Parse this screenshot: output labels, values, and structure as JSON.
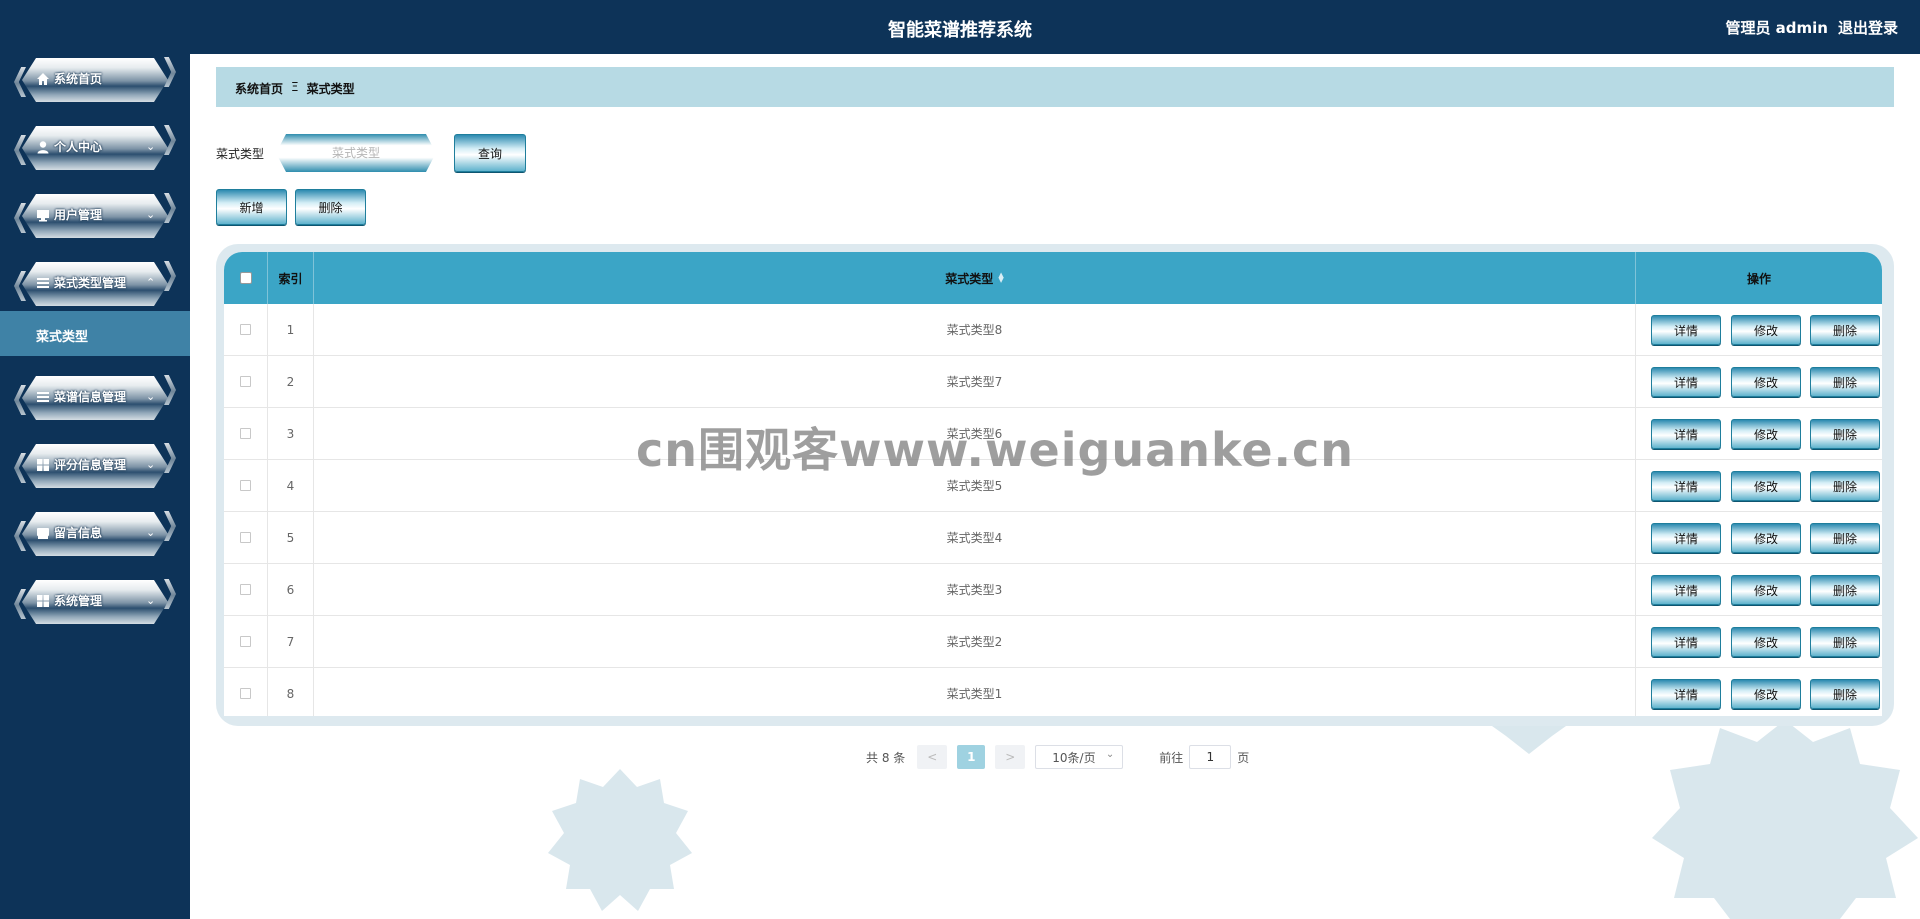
{
  "app": {
    "title": "智能菜谱推荐系统",
    "user_label": "管理员 admin",
    "logout_label": "退出登录"
  },
  "sidebar": {
    "items": [
      {
        "label": "系统首页",
        "icon": "home-icon",
        "arrow": ""
      },
      {
        "label": "个人中心",
        "icon": "user-icon",
        "arrow": "⌄"
      },
      {
        "label": "用户管理",
        "icon": "monitor-icon",
        "arrow": "⌄"
      },
      {
        "label": "菜式类型管理",
        "icon": "list-icon",
        "arrow": "⌃"
      },
      {
        "label": "菜谱信息管理",
        "icon": "list-icon",
        "arrow": "⌄"
      },
      {
        "label": "评分信息管理",
        "icon": "grid-icon",
        "arrow": "⌄"
      },
      {
        "label": "留言信息",
        "icon": "message-icon",
        "arrow": "⌄"
      },
      {
        "label": "系统管理",
        "icon": "grid-icon",
        "arrow": "⌄"
      }
    ],
    "sub_item": "菜式类型"
  },
  "breadcrumb": {
    "home": "系统首页",
    "separator": "Ξ",
    "current": "菜式类型"
  },
  "search": {
    "label": "菜式类型",
    "placeholder": "菜式类型",
    "value": "",
    "query_button": "查询"
  },
  "toolbar": {
    "add_button": "新增",
    "delete_button": "删除"
  },
  "table": {
    "headers": {
      "index": "索引",
      "type": "菜式类型",
      "actions": "操作"
    },
    "action_labels": {
      "detail": "详情",
      "edit": "修改",
      "delete": "删除"
    },
    "rows": [
      {
        "index": "1",
        "type": "菜式类型8"
      },
      {
        "index": "2",
        "type": "菜式类型7"
      },
      {
        "index": "3",
        "type": "菜式类型6"
      },
      {
        "index": "4",
        "type": "菜式类型5"
      },
      {
        "index": "5",
        "type": "菜式类型4"
      },
      {
        "index": "6",
        "type": "菜式类型3"
      },
      {
        "index": "7",
        "type": "菜式类型2"
      },
      {
        "index": "8",
        "type": "菜式类型1"
      }
    ]
  },
  "pagination": {
    "total": "共 8 条",
    "prev": "<",
    "page": "1",
    "next": ">",
    "page_size": "10条/页",
    "goto_label": "前往",
    "goto_value": "1",
    "page_unit": "页"
  },
  "watermark": "cn围观客www.weiguanke.cn",
  "colors": {
    "header_bg": "#0d3358",
    "table_head": "#3ba5c6",
    "breadcrumb_bg": "#b7dae4",
    "sub_active": "#3f82a6"
  }
}
